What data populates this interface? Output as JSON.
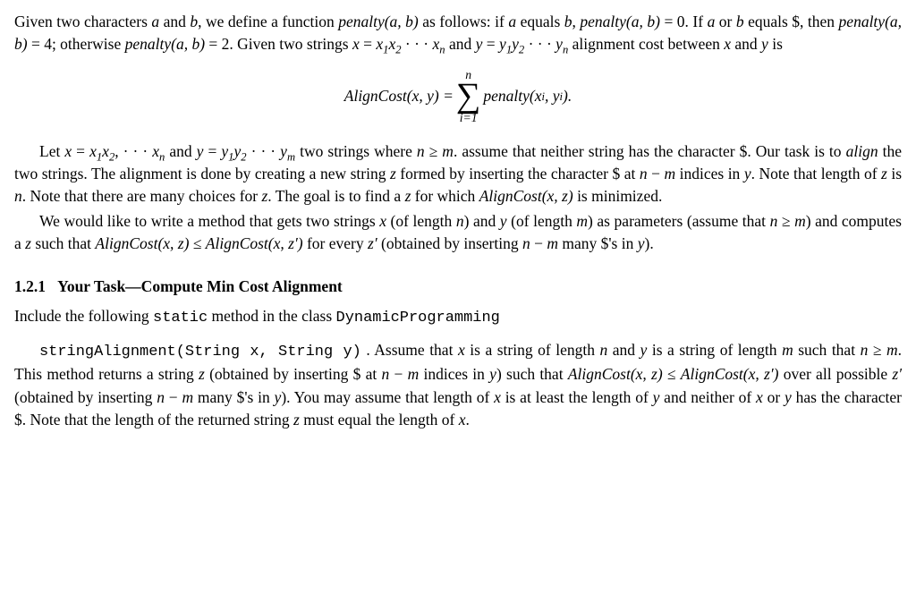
{
  "para1": {
    "t1": "Given two characters ",
    "a": "a",
    "t2": " and ",
    "b": "b",
    "t3": ", we define a function ",
    "pen1": "penalty",
    "arg1": "(a, b)",
    "t4": " as follows: if ",
    "a2": "a",
    "t5": " equals ",
    "b2": "b",
    "t6": ", ",
    "pen2": "penalty",
    "arg2": "(a, b)",
    "t7": " = 0.  If ",
    "a3": "a",
    "t8": " or ",
    "b3": "b",
    "t9": " equals $, then ",
    "pen3": "penalty",
    "arg3": "(a, b)",
    "eq4": " = 4; otherwise ",
    "pen4": "penalty",
    "arg4": "(a, b)",
    "eq2": " = 2.  Given two strings ",
    "x": "x",
    "eq": " = ",
    "x1": "x",
    "s1": "1",
    "x2": "x",
    "s2": "2",
    "dots": " · · · ",
    "xn": "x",
    "sn": "n",
    "t10": " and ",
    "y": "y",
    "eqy": " = ",
    "y1": "y",
    "sy1": "1",
    "y2": "y",
    "sy2": "2",
    "ydots": " · · · ",
    "yn": "y",
    "syn": "n",
    "t11": " alignment cost between ",
    "xx": "x",
    "t12": " and ",
    "yy": "y",
    "t13": " is"
  },
  "displayeq": {
    "lhs": "AlignCost",
    "lhsarg": "(x, y) = ",
    "sumtop": "n",
    "sigma": "∑",
    "sumbot": "i=1",
    "rhsfun": "penalty",
    "rhsarg": "(x",
    "si": "i",
    "rhsarg2": ", y",
    "si2": "i",
    "rhsarg3": ")."
  },
  "para2": {
    "t1": "Let ",
    "x": "x",
    "eq": " = ",
    "x1": "x",
    "s1": "1",
    "x2": "x",
    "s2": "2",
    "c1": ", ",
    "dots": "· · · ",
    "xn": "x",
    "sn": "n",
    "t2": " and ",
    "y": "y",
    "eqy": " = ",
    "y1": "y",
    "sy1": "1",
    "y2": "y",
    "sy2": "2",
    "ydots": " · · · ",
    "ym": "y",
    "sym": "m",
    "t3": " two strings where ",
    "n": "n",
    "geq": " ≥ ",
    "m": "m",
    "t4": ". assume that neither string has the character $. Our task is to ",
    "align": "align",
    "t5": " the two strings. The alignment is done by creating a new string ",
    "z": "z",
    "t6": " formed by inserting the character $ at ",
    "n2": "n",
    "minus": " − ",
    "m2": "m",
    "t7": " indices in ",
    "y3": "y",
    "t8": ". Note that length of ",
    "z2": "z",
    "t9": " is ",
    "n3": "n",
    "t10": ". Note that there are many choices for ",
    "z3": "z",
    "t11": ". The goal is to find a ",
    "z4": "z",
    "t12": " for which ",
    "ac": "AlignCost",
    "acarg": "(x, z)",
    "t13": " is minimized."
  },
  "para3": {
    "t1": "We would like to write a method that gets two strings ",
    "x": "x",
    "t2": " (of length ",
    "n": "n",
    "t3": ") and ",
    "y": "y",
    "t4": " (of length ",
    "m": "m",
    "t5": ") as parameters (assume that ",
    "n2": "n",
    "geq": " ≥ ",
    "m2": "m",
    "t6": ") and computes a ",
    "z": "z",
    "t7": " such that ",
    "ac1": "AlignCost",
    "ac1a": "(x, z)",
    "leq": " ≤ ",
    "ac2": "AlignCost",
    "ac2a": "(x, z′)",
    "t8": " for every ",
    "zp": "z′",
    "t9": " (obtained by inserting ",
    "n3": "n",
    "minus": " − ",
    "m3": "m",
    "t10": " many $'s in ",
    "y2": "y",
    "t11": ")."
  },
  "heading": {
    "num": "1.2.1",
    "title": "Your Task—Compute Min Cost Alignment"
  },
  "para4": {
    "t1": "Include the following ",
    "static": "static",
    "t2": " method in the class ",
    "cls": "DynamicProgramming"
  },
  "para5": {
    "sig": "stringAlignment(String x, String y)",
    "t1": " .  Assume that ",
    "x": "x",
    "t2": " is a string of length ",
    "n": "n",
    "t3": " and ",
    "y": "y",
    "t4": " is a string of length ",
    "m": "m",
    "t5": " such that ",
    "n2": "n",
    "geq": " ≥ ",
    "m2": "m",
    "t6": ". This method returns a string ",
    "z": "z",
    "t7": " (obtained by inserting $ at ",
    "n3": "n",
    "minus": " − ",
    "m3": "m",
    "t8": " indices in ",
    "y2": "y",
    "t9": ") such that ",
    "ac1": "AlignCost",
    "ac1a": "(x, z)",
    "leq": " ≤ ",
    "ac2": "AlignCost",
    "ac2a": "(x, z′)",
    "t10": " over all possible ",
    "zp": "z′",
    "t11": " (obtained by inserting ",
    "n4": "n",
    "minus2": " − ",
    "m4": "m",
    "t12": " many $'s in ",
    "y3": "y",
    "t13": "). You may assume that length of ",
    "x2": "x",
    "t14": " is at least the length of ",
    "y4": "y",
    "t15": " and neither of ",
    "x3": "x",
    "t16": " or ",
    "y5": "y",
    "t17": " has the character $. Note that the length of the returned string ",
    "z2": "z",
    "t18": " must equal the length of ",
    "x4": "x",
    "t19": "."
  }
}
